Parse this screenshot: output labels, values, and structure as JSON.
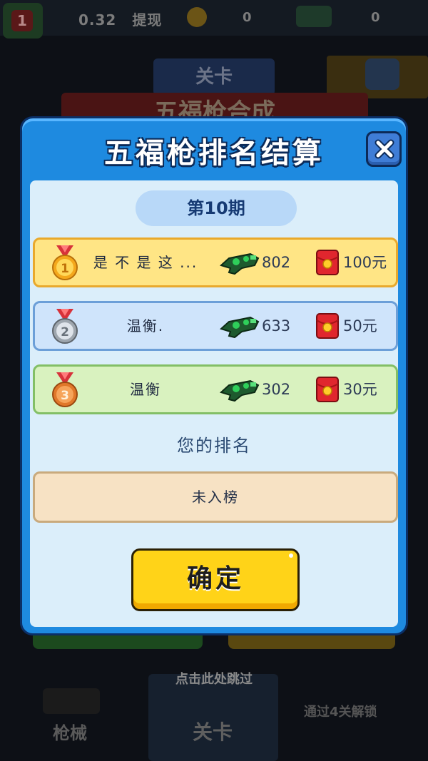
{
  "background": {
    "money_text": "0.32",
    "withdraw_label": "提现",
    "zero_left": "0",
    "zero_right": "0",
    "level_tab": "关卡",
    "banner_title": "五福枪合成",
    "skip_hint": "点击此处跳过",
    "tab_guns": "枪械",
    "tab_levels": "关卡",
    "unlock_hint": "通过4关解锁"
  },
  "modal": {
    "title": "五福枪排名结算",
    "period": "第10期",
    "rankings": [
      {
        "rank": 1,
        "medal": "gold-medal-icon",
        "name": "是 不 是 这 ...",
        "score": "802",
        "reward": "100元"
      },
      {
        "rank": 2,
        "medal": "silver-medal-icon",
        "name": "温衡.",
        "score": "633",
        "reward": "50元"
      },
      {
        "rank": 3,
        "medal": "bronze-medal-icon",
        "name": "温衡",
        "score": "302",
        "reward": "30元"
      }
    ],
    "your_rank_label": "您的排名",
    "your_rank_value": "未入榜",
    "confirm_label": "确定"
  },
  "colors": {
    "modal_blue": "#1e8ae0",
    "panel": "#dbeefa",
    "gold_row": "#ffe585",
    "silver_row": "#cfe4fb",
    "bronze_row": "#d9f2bf",
    "confirm": "#ffd318"
  }
}
